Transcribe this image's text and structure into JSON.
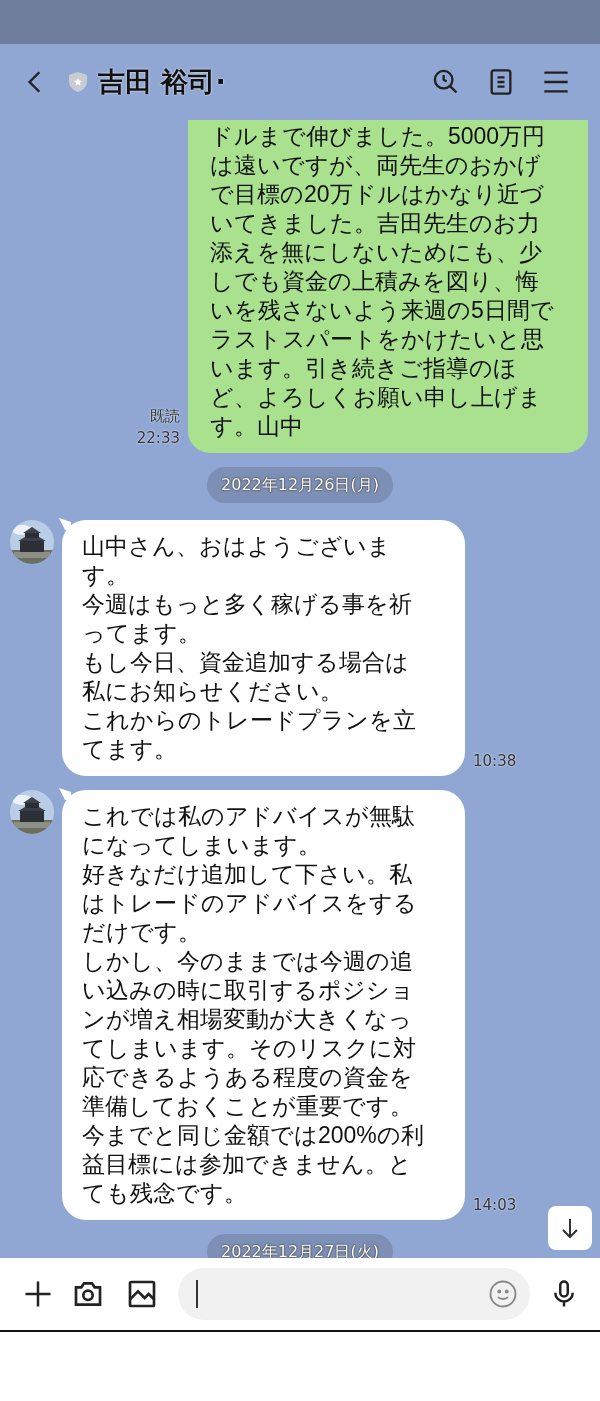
{
  "header": {
    "title": "吉田 裕司·"
  },
  "messages": [
    {
      "kind": "outgoing",
      "paragraphs": [
        "ドルまで伸びました。5000万円は遠いですが、両先生のおかげで目標の20万ドルはかなり近づいてきました。吉田先生のお力添えを無にしないためにも、少しでも資金の上積みを図り、悔いを残さないよう来週の5日間でラストスパートをかけたいと思います。引き続きご指導のほど、よろしくお願い申し上げます。山中"
      ],
      "read": "既読",
      "time": "22:33"
    },
    {
      "kind": "date",
      "text": "2022年12月26日(月)"
    },
    {
      "kind": "incoming",
      "paragraphs": [
        "山中さん、おはようございます。",
        "今週はもっと多く稼げる事を祈ってます。",
        "もし今日、資金追加する場合は私にお知らせください。",
        "これからのトレードプランを立てます。"
      ],
      "time": "10:38"
    },
    {
      "kind": "incoming",
      "paragraphs": [
        "これでは私のアドバイスが無駄になってしまいます。",
        "好きなだけ追加して下さい。私はトレードのアドバイスをするだけです。",
        "しかし、今のままでは今週の追い込みの時に取引するポジションが増え相場変動が大きくなってしまいます。そのリスクに対応できるようある程度の資金を準備しておくことが重要です。",
        "今までと同じ金額では200%の利益目標には参加できません。とても残念です。"
      ],
      "time": "14:03"
    },
    {
      "kind": "date",
      "text": "2022年12月27日(火)"
    }
  ]
}
